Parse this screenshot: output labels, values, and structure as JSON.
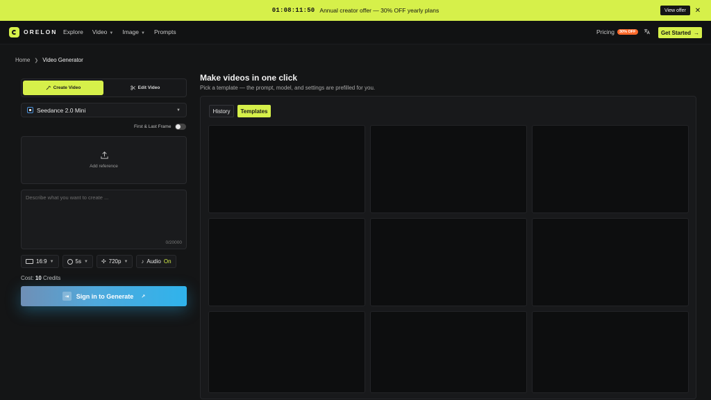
{
  "promo": {
    "timer": "01:08:11:50",
    "message": "Annual creator offer — 30% OFF yearly plans",
    "view_offer": "View offer",
    "close": "✕"
  },
  "nav": {
    "brand": "ORELON",
    "links": [
      {
        "label": "Explore",
        "caret": ""
      },
      {
        "label": "Video",
        "caret": "▼"
      },
      {
        "label": "Image",
        "caret": "▼"
      },
      {
        "label": "Prompts",
        "caret": ""
      }
    ],
    "pricing": "Pricing",
    "pricing_badge": "30% OFF",
    "get_started": "Get Started",
    "get_started_arrow": "→"
  },
  "breadcrumb": {
    "home": "Home",
    "current": "Video Generator"
  },
  "generator": {
    "tab_create": "Create Video",
    "tab_edit": "Edit Video",
    "model": "Seedance 2.0 Mini",
    "first_last_frame": "First & Last Frame",
    "add_reference": "Add reference",
    "prompt_placeholder": "Describe what you want to create ...",
    "char_counter": "0/20000",
    "aspect_ratio": "16:9",
    "duration": "5s",
    "resolution": "720p",
    "audio_label": "Audio",
    "audio_state": "On",
    "cost_label": "Cost:",
    "cost_value": "10",
    "cost_unit": "Credits",
    "generate": "Sign in to Generate"
  },
  "main": {
    "title": "Make videos in one click",
    "subtitle": "Pick a template — the prompt, model, and settings are prefilled for you.",
    "tab_history": "History",
    "tab_templates": "Templates"
  },
  "colors": {
    "accent": "#d6f04a",
    "background": "#141516",
    "generate_gradient_end": "#2fb3ec"
  }
}
